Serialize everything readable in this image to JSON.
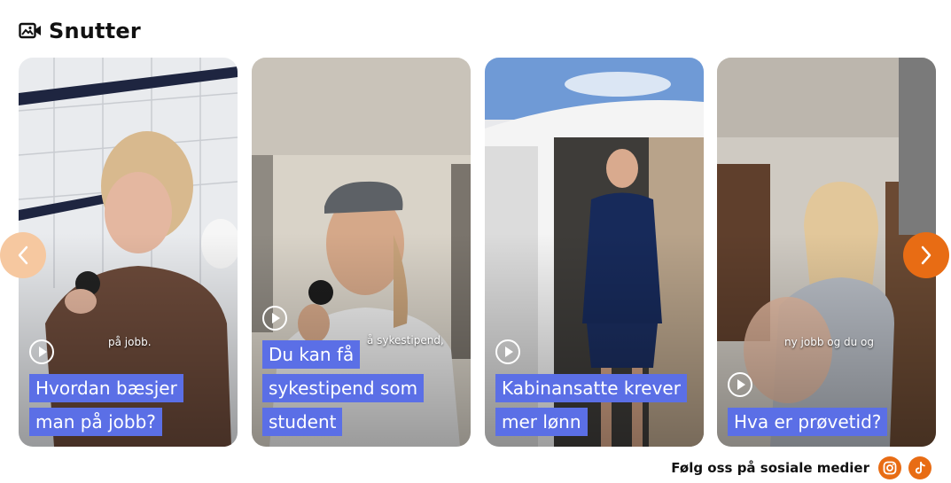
{
  "section": {
    "title": "Snutter",
    "icon": "video-gallery-icon"
  },
  "cards": [
    {
      "subtitle": "på jobb.",
      "caption_lines": [
        "Hvordan bæsjer",
        "man på jobb?"
      ]
    },
    {
      "subtitle": "å sykestipend,",
      "caption_lines": [
        "Du kan få",
        "sykestipend som",
        "student"
      ]
    },
    {
      "subtitle": "",
      "caption_lines": [
        "Kabinansatte krever",
        "mer lønn"
      ]
    },
    {
      "subtitle": "ny jobb og du og",
      "caption_lines": [
        "Hva er prøvetid?"
      ]
    }
  ],
  "footer": {
    "label": "Følg oss på sosiale medier",
    "icons": [
      "instagram-icon",
      "tiktok-icon"
    ]
  },
  "colors": {
    "accent": "#e86c14",
    "accent_light": "#f6c8a0",
    "caption_bg": "#5b6fe6"
  }
}
